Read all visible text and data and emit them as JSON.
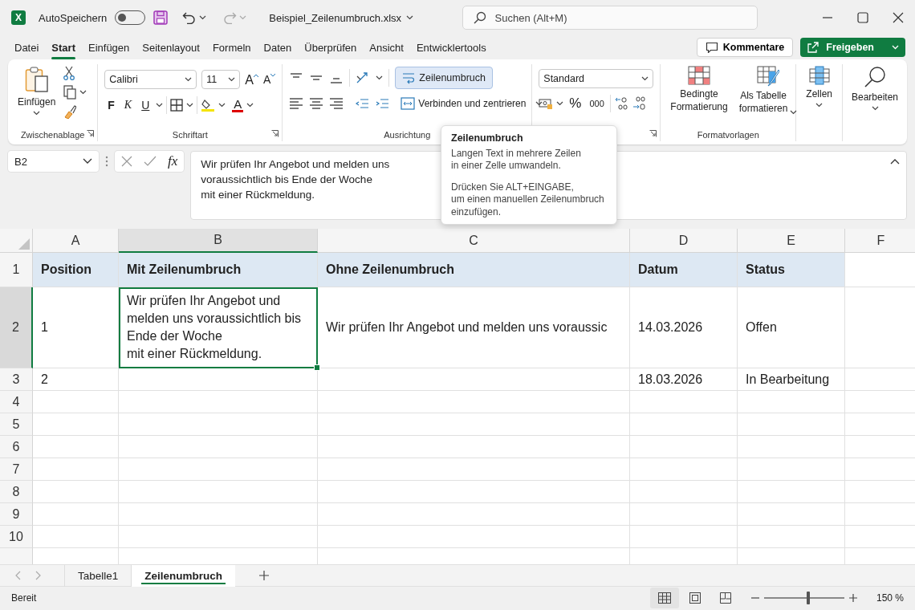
{
  "title_bar": {
    "app_logo": "X",
    "autosave_label": "AutoSpeichern",
    "autosave_on": false,
    "file_name": "Beispiel_Zeilenumbruch.xlsx",
    "search_placeholder": "Suchen (Alt+M)"
  },
  "menu_tabs": [
    {
      "label": "Datei",
      "selected": false
    },
    {
      "label": "Start",
      "selected": true
    },
    {
      "label": "Einfügen",
      "selected": false
    },
    {
      "label": "Seitenlayout",
      "selected": false
    },
    {
      "label": "Formeln",
      "selected": false
    },
    {
      "label": "Daten",
      "selected": false
    },
    {
      "label": "Überprüfen",
      "selected": false
    },
    {
      "label": "Ansicht",
      "selected": false
    },
    {
      "label": "Entwicklertools",
      "selected": false
    }
  ],
  "comments_button": "Kommentare",
  "share_button": "Freigeben",
  "ribbon": {
    "clipboard": {
      "paste": "Einfügen",
      "label": "Zwischenablage"
    },
    "font": {
      "name": "Calibri",
      "size": "11",
      "grow": "A",
      "shrink": "A",
      "bold": "F",
      "italic": "K",
      "underline": "U",
      "color_letter": "A",
      "label": "Schriftart"
    },
    "alignment": {
      "wrap_text": {
        "label": "Zeilenumbruch",
        "selected": true
      },
      "merge": "Verbinden und zentrieren",
      "label": "Ausrichtung"
    },
    "number": {
      "format": "Standard",
      "percent": "%",
      "thousands": "000"
    },
    "styles": {
      "conditional": "Bedingte\nFormatierung",
      "as_table": "Als Tabelle\nformatieren",
      "label": "Formatvorlagen"
    },
    "cells": "Zellen",
    "editing": "Bearbeiten"
  },
  "formula_bar": {
    "name_box": "B2",
    "fx": "fx",
    "value": "Wir prüfen Ihr Angebot und melden uns\nvoraussichtlich bis Ende der Woche\nmit einer Rückmeldung."
  },
  "tooltip": {
    "title": "Zeilenumbruch",
    "paragraphs": [
      "Langen Text in mehrere Zeilen\nin einer Zelle umwandeln.",
      "Drücken Sie ALT+EINGABE,\num einen manuellen Zeilenumbruch\neinzufügen."
    ]
  },
  "sheet": {
    "columns": [
      {
        "label": "A",
        "selected": false
      },
      {
        "label": "B",
        "selected": true
      },
      {
        "label": "C",
        "selected": false
      },
      {
        "label": "D",
        "selected": false
      },
      {
        "label": "E",
        "selected": false
      },
      {
        "label": "F",
        "selected": false
      }
    ],
    "rows": [
      {
        "label": "1",
        "kind": "header",
        "selected": false,
        "cells": {
          "A": "Position",
          "B": "Mit Zeilenumbruch",
          "C": "Ohne Zeilenumbruch",
          "D": "Datum",
          "E": "Status"
        }
      },
      {
        "label": "2",
        "kind": "data",
        "selected": true,
        "cells": {
          "A": "1",
          "B": "Wir prüfen Ihr Angebot und\nmelden uns voraussichtlich bis\nEnde der Woche\nmit einer Rückmeldung.",
          "C": "Wir prüfen Ihr Angebot und melden uns voraussic",
          "D": "14.03.2026",
          "E": "Offen"
        }
      },
      {
        "label": "3",
        "kind": "data",
        "selected": false,
        "cells": {
          "A": "2",
          "D": "18.03.2026",
          "E": "In Bearbeitung"
        }
      },
      {
        "label": "4",
        "kind": "data",
        "selected": false
      },
      {
        "label": "5",
        "kind": "data",
        "selected": false
      },
      {
        "label": "6",
        "kind": "data",
        "selected": false
      },
      {
        "label": "7",
        "kind": "data",
        "selected": false
      },
      {
        "label": "8",
        "kind": "data",
        "selected": false
      },
      {
        "label": "9",
        "kind": "data",
        "selected": false
      },
      {
        "label": "10",
        "kind": "data",
        "selected": false
      }
    ]
  },
  "sheet_tabs": [
    {
      "label": "Tabelle1",
      "selected": false
    },
    {
      "label": "Zeilenumbruch",
      "selected": true
    }
  ],
  "status_bar": {
    "status": "Bereit",
    "views": [
      {
        "kind": "normal",
        "selected": true
      },
      {
        "kind": "page_layout",
        "selected": false
      },
      {
        "kind": "page_break",
        "selected": false
      }
    ],
    "zoom": {
      "level": 0.55,
      "reading": "150 %"
    }
  }
}
